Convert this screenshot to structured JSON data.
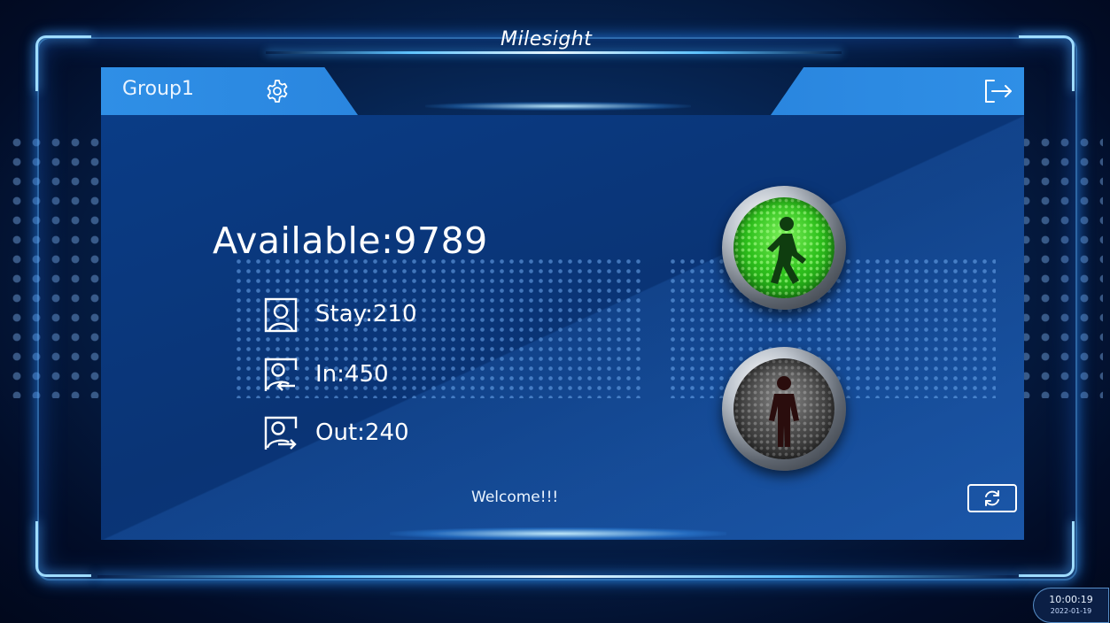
{
  "header": {
    "logo_text": "Milesight",
    "group_name": "Group1",
    "settings_icon": "gear-icon",
    "exit_icon": "exit-icon"
  },
  "stats": {
    "available": "Available:9789",
    "stay": "Stay:210",
    "in": "In:450",
    "out": "Out:240"
  },
  "signals": {
    "go_state": "green",
    "stop_state": "off"
  },
  "footer": {
    "welcome": "Welcome!!!",
    "refresh_icon": "refresh-icon"
  },
  "clock": {
    "time": "10:00:19",
    "date": "2022-01-19"
  },
  "colors": {
    "accent_blue": "#2f8fe6",
    "go_green": "#2fc21d",
    "panel_blue": "#0a3c86"
  }
}
